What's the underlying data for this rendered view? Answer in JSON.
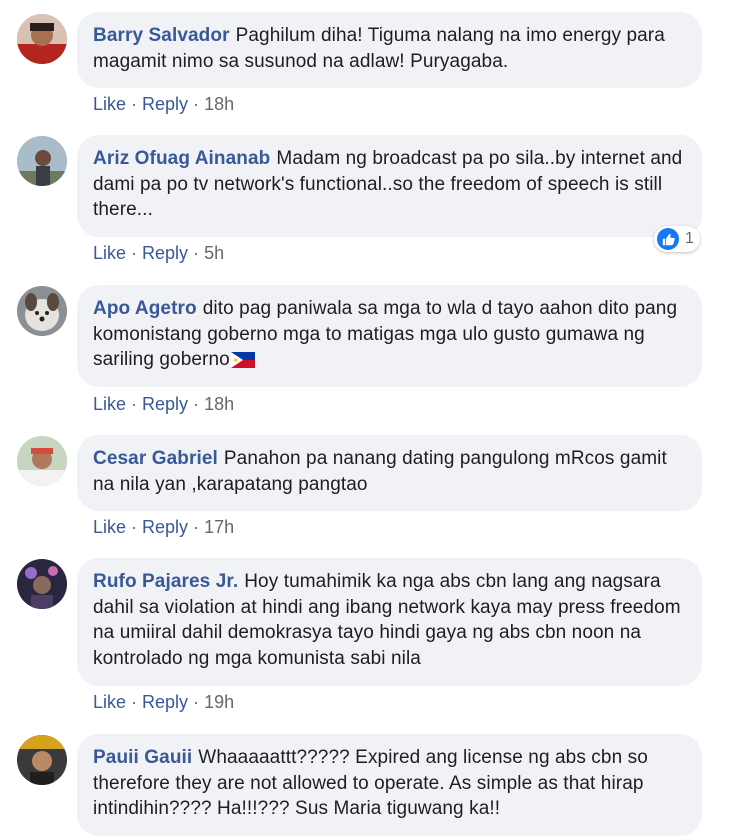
{
  "actions": {
    "like": "Like",
    "reply": "Reply",
    "separator": "·"
  },
  "comments": [
    {
      "author": "Barry Salvador",
      "text": "Paghilum diha! Tiguma nalang na imo energy para magamit nimo sa susunod na adlaw! Puryagaba.",
      "time": "18h"
    },
    {
      "author": "Ariz Ofuag Ainanab",
      "text": "Madam ng broadcast pa po sila..by internet and dami pa po tv network's functional..so the freedom of speech is still there...",
      "time": "5h",
      "reaction": {
        "icon": "like-icon",
        "count": "1"
      }
    },
    {
      "author": "Apo Agetro",
      "text": "dito pag paniwala sa mga to wla d tayo aahon dito pang komonistang goberno mga to matigas mga ulo gusto gumawa ng sariling goberno",
      "emoji": "philippines-flag-icon",
      "time": "18h"
    },
    {
      "author": "Cesar Gabriel",
      "text": "Panahon pa nanang dating pangulong mRcos gamit na nila yan ,karapatang pangtao",
      "time": "17h"
    },
    {
      "author": "Rufo Pajares Jr.",
      "text": "Hoy tumahimik ka nga abs cbn lang ang nagsara dahil sa violation at hindi ang ibang network kaya may press freedom na umiiral dahil demokrasya tayo hindi gaya ng abs cbn noon na kontrolado ng mga komunista sabi nila",
      "time": "19h"
    },
    {
      "author": "Pauii Gauii",
      "text": "Whaaaaattt????? Expired ang license ng abs cbn so therefore they are not allowed to operate. As simple as that hirap intindihin???? Ha!!!??? Sus Maria tiguwang ka!!"
    }
  ],
  "colors": {
    "author": "#385898",
    "bubble": "#f0f2f5",
    "meta": "#65676b",
    "like_badge": "#1877f2"
  }
}
